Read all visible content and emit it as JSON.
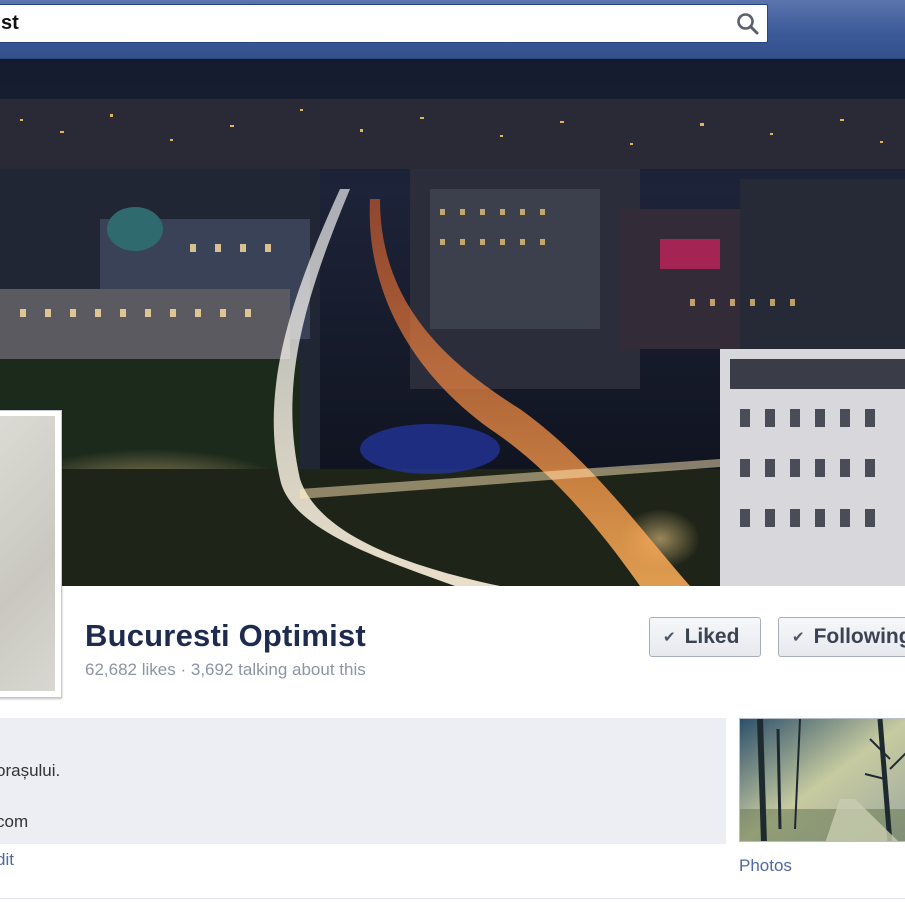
{
  "search": {
    "value": "st"
  },
  "icons": {
    "search": "search-icon",
    "check": "checkmark-icon"
  },
  "page": {
    "title": "Bucuresti Optimist",
    "likes": "62,682 likes",
    "separator": "·",
    "talking": "3,692 talking about this"
  },
  "buttons": {
    "liked": "Liked",
    "following": "Following"
  },
  "about": {
    "line1": "orașului.",
    "line2": "com",
    "edit": "dit"
  },
  "photos": {
    "label": "Photos"
  },
  "colors": {
    "topbar": "#3b5998",
    "title": "#1d2b4f",
    "link": "#4e69a2",
    "about_bg": "#eceef3"
  }
}
